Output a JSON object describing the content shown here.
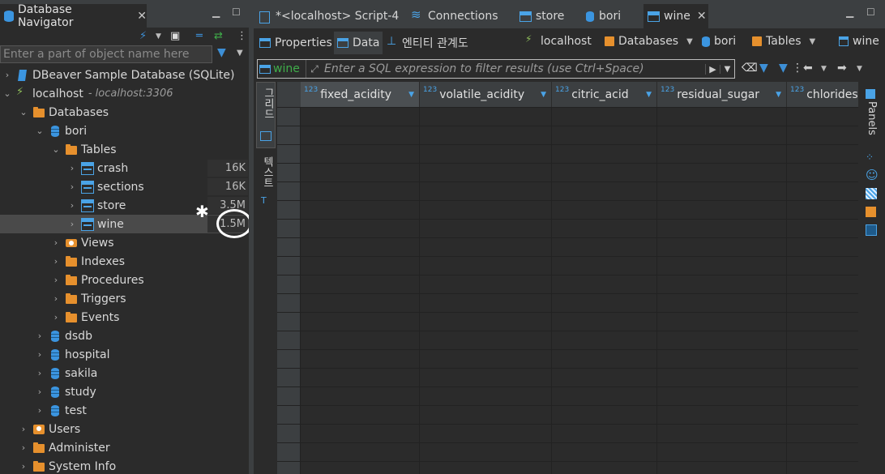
{
  "navigator": {
    "title": "Database Navigator",
    "filter_placeholder": "Enter a part of object name here",
    "tree": [
      {
        "label": "DBeaver Sample Database (SQLite)",
        "level": 0,
        "chevron": "›",
        "icon": "sqlite"
      },
      {
        "label": "localhost",
        "sub": "- localhost:3306",
        "level": 0,
        "chevron": "⌄",
        "icon": "conn"
      },
      {
        "label": "Databases",
        "level": 1,
        "chevron": "⌄",
        "icon": "folder"
      },
      {
        "label": "bori",
        "level": 2,
        "chevron": "⌄",
        "icon": "db"
      },
      {
        "label": "Tables",
        "level": 3,
        "chevron": "⌄",
        "icon": "folder"
      },
      {
        "label": "crash",
        "level": 4,
        "chevron": "›",
        "icon": "table",
        "size": "16K"
      },
      {
        "label": "sections",
        "level": 4,
        "chevron": "›",
        "icon": "table",
        "size": "16K"
      },
      {
        "label": "store",
        "level": 4,
        "chevron": "›",
        "icon": "table",
        "size": "3.5M"
      },
      {
        "label": "wine",
        "level": 4,
        "chevron": "›",
        "icon": "table",
        "size": "1.5M",
        "selected": true
      },
      {
        "label": "Views",
        "level": 3,
        "chevron": "›",
        "icon": "views"
      },
      {
        "label": "Indexes",
        "level": 3,
        "chevron": "›",
        "icon": "folder"
      },
      {
        "label": "Procedures",
        "level": 3,
        "chevron": "›",
        "icon": "folder"
      },
      {
        "label": "Triggers",
        "level": 3,
        "chevron": "›",
        "icon": "folder"
      },
      {
        "label": "Events",
        "level": 3,
        "chevron": "›",
        "icon": "folder"
      },
      {
        "label": "dsdb",
        "level": 2,
        "chevron": "›",
        "icon": "db"
      },
      {
        "label": "hospital",
        "level": 2,
        "chevron": "›",
        "icon": "db"
      },
      {
        "label": "sakila",
        "level": 2,
        "chevron": "›",
        "icon": "db"
      },
      {
        "label": "study",
        "level": 2,
        "chevron": "›",
        "icon": "db"
      },
      {
        "label": "test",
        "level": 2,
        "chevron": "›",
        "icon": "db"
      },
      {
        "label": "Users",
        "level": 1,
        "chevron": "›",
        "icon": "users"
      },
      {
        "label": "Administer",
        "level": 1,
        "chevron": "›",
        "icon": "folder"
      },
      {
        "label": "System Info",
        "level": 1,
        "chevron": "›",
        "icon": "folder"
      }
    ]
  },
  "editor_tabs": [
    {
      "label": "*<localhost> Script-4",
      "icon": "script"
    },
    {
      "label": "Connections",
      "icon": "conn"
    },
    {
      "label": "store",
      "icon": "table"
    },
    {
      "label": "bori",
      "icon": "db"
    },
    {
      "label": "wine",
      "icon": "table",
      "active": true
    }
  ],
  "sub_tabs": [
    {
      "label": "Properties"
    },
    {
      "label": "Data",
      "active": true
    },
    {
      "label": "엔티티 관계도"
    }
  ],
  "breadcrumbs": [
    "localhost",
    "Databases",
    "bori",
    "Tables",
    "wine"
  ],
  "filter": {
    "entity": "wine",
    "placeholder": "Enter a SQL expression to filter results (use Ctrl+Space)"
  },
  "vertical_tabs": {
    "grid": "그리드",
    "text": "텍스트"
  },
  "panels_label": "Panels",
  "columns": [
    {
      "type": "123",
      "name": "fixed_acidity"
    },
    {
      "type": "123",
      "name": "volatile_acidity"
    },
    {
      "type": "123",
      "name": "citric_acid"
    },
    {
      "type": "123",
      "name": "residual_sugar"
    },
    {
      "type": "123",
      "name": "chlorides"
    }
  ],
  "colors": {
    "accent": "#4aa3e6",
    "folder": "#e6902d",
    "entity": "#3fae4a"
  }
}
